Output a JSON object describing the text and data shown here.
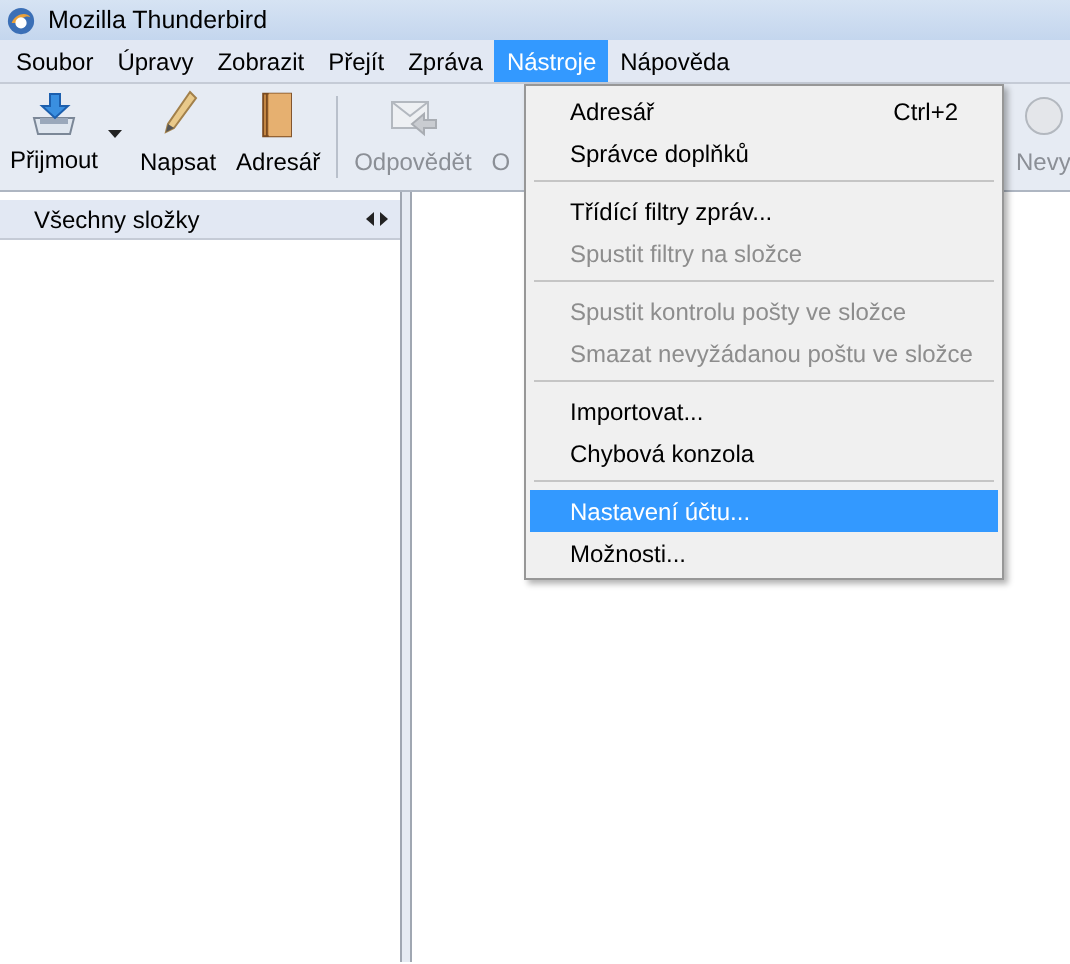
{
  "window": {
    "title": "Mozilla Thunderbird"
  },
  "menubar": [
    {
      "label": "Soubor",
      "selected": false
    },
    {
      "label": "Úpravy",
      "selected": false
    },
    {
      "label": "Zobrazit",
      "selected": false
    },
    {
      "label": "Přejít",
      "selected": false
    },
    {
      "label": "Zpráva",
      "selected": false
    },
    {
      "label": "Nástroje",
      "selected": true
    },
    {
      "label": "Nápověda",
      "selected": false
    }
  ],
  "toolbar": [
    {
      "kind": "get",
      "label": "Přijmout",
      "disabled": false,
      "dropdown": true
    },
    {
      "kind": "write",
      "label": "Napsat",
      "disabled": false
    },
    {
      "kind": "book",
      "label": "Adresář",
      "disabled": false
    },
    {
      "kind": "separator"
    },
    {
      "kind": "reply",
      "label": "Odpovědět",
      "disabled": true
    },
    {
      "kind": "covered",
      "label": "O",
      "disabled": true
    },
    {
      "kind": "edge",
      "label": "Nevy",
      "disabled": true
    }
  ],
  "folder_pane": {
    "title": "Všechny složky"
  },
  "menu": [
    {
      "kind": "item",
      "label": "Adresář",
      "shortcut": "Ctrl+2",
      "disabled": false,
      "selected": false
    },
    {
      "kind": "item",
      "label": "Správce doplňků",
      "disabled": false,
      "selected": false
    },
    {
      "kind": "separator"
    },
    {
      "kind": "item",
      "label": "Třídící filtry zpráv...",
      "disabled": false,
      "selected": false
    },
    {
      "kind": "item",
      "label": "Spustit filtry na složce",
      "disabled": true,
      "selected": false
    },
    {
      "kind": "separator"
    },
    {
      "kind": "item",
      "label": "Spustit kontrolu pošty ve složce",
      "disabled": true,
      "selected": false
    },
    {
      "kind": "item",
      "label": "Smazat nevyžádanou poštu ve složce",
      "disabled": true,
      "selected": false
    },
    {
      "kind": "separator"
    },
    {
      "kind": "item",
      "label": "Importovat...",
      "disabled": false,
      "selected": false
    },
    {
      "kind": "item",
      "label": "Chybová konzola",
      "disabled": false,
      "selected": false
    },
    {
      "kind": "separator"
    },
    {
      "kind": "item",
      "label": "Nastavení účtu...",
      "disabled": false,
      "selected": true
    },
    {
      "kind": "item",
      "label": "Možnosti...",
      "disabled": false,
      "selected": false
    }
  ]
}
